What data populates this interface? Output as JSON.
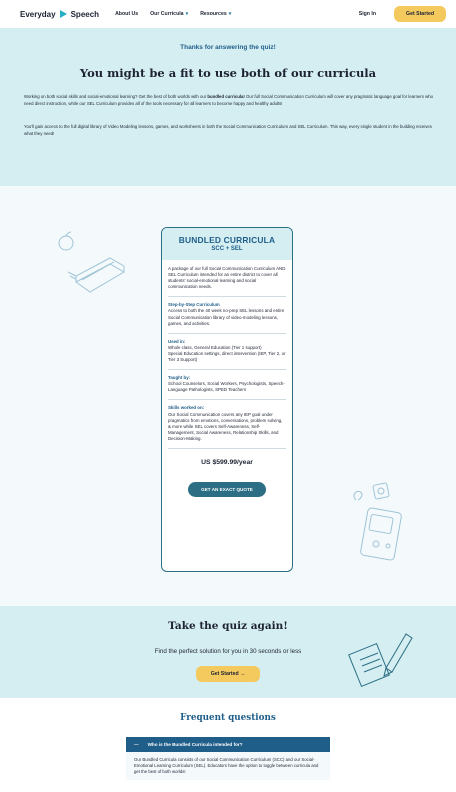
{
  "header": {
    "brand_left": "Everyday",
    "brand_right": "Speech",
    "nav": [
      {
        "label": "About Us",
        "has_caret": false
      },
      {
        "label": "Our Curricula",
        "has_caret": true
      },
      {
        "label": "Resources",
        "has_caret": true
      }
    ],
    "sign_in": "Sign In",
    "cta": "Get Started",
    "caret": "▾"
  },
  "hero": {
    "kicker": "Thanks for answering the quiz!",
    "title": "You might be a fit to use both of our curricula",
    "p1_before": "Working on both social skills and social-emotional learning? Get the best of both worlds with our ",
    "p1_bold": "bundled curricula!",
    "p1_after": " Our full Social Communication Curriculum will cover any pragmatic language goal for learners who need direct instruction, while our SEL Curriculum provides all of the tools necessary for all learners to become happy and healthy adults!",
    "p2": "You'll gain access to the full digital library of Video Modeling lessons, games, and worksheets in both the Social Communication Curriculum and SEL Curriculum. This way, every single student in the building receives what they need!"
  },
  "product": {
    "title": "BUNDLED CURRICULA",
    "subtitle": "SCC + SEL",
    "intro": "A package of our full Social Communication Curriculum AND SEL Curriculum intended for an entire district to cover all students' social-emotional learning and social communication needs.",
    "step_label": "Step-by-Step Curriculum",
    "step_text": "Access to both the 40 week no-prep SEL lessons and entire Social Communication library of video-modeling lessons, games, and activities.",
    "used_label": "Used in:",
    "used_text_1": "Whole class, General Education (Tier 1 support)",
    "used_text_2": "Special Education settings, direct intervention (IEP, Tier 2, or Tier 3 Support)",
    "taught_label": "Taught by:",
    "taught_text": "School Counselors, Social Workers, Psychologists, Speech-Language Pathologists, SPED Teachers",
    "skills_label": "Skills worked on:",
    "skills_text": "Our Social Communication covers any IEP goal under pragmatics from emotions, conversations, problem solving, & more while SEL covers Self-Awareness, Self-Management, Social Awareness, Relationship Skills, and Decision-Making.",
    "price": "US $599.99/year",
    "quote_button": "GET AN EXACT QUOTE"
  },
  "quiz": {
    "title": "Take the quiz again!",
    "subtitle": "Find the perfect solution for you in 30 seconds or less",
    "cta": "Get Started →"
  },
  "faq": {
    "title": "Frequent questions",
    "question": "Who is the Bundled Curricula intended for?",
    "toggle": "—",
    "answer": "Our Bundled Curricula consists of our Social Communication Curriculum (SCC) and our Social-Emotional Learning Curriculum (SEL). Educators have the option to toggle between curricula and get the best of both worlds!"
  },
  "colors": {
    "hero_bg": "#d5eef2",
    "section_bg": "#f4fafc",
    "accent_teal": "#2c6f85",
    "heading_blue": "#1f5e89",
    "cta_yellow": "#f4c95e",
    "brand_triangle": "#27b0c5"
  },
  "icons": [
    "play-triangle-logo-icon",
    "book-apple-illustration-icon",
    "game-device-illustration-icon",
    "paper-pencil-illustration-icon"
  ]
}
